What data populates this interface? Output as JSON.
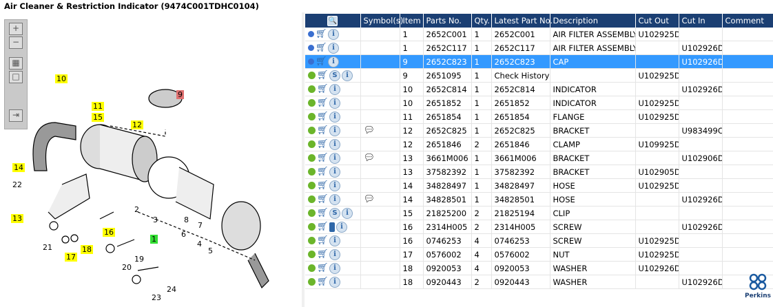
{
  "title": "Air Cleaner & Restriction Indicator (9474C001TDHC0104)",
  "headers": [
    "",
    "Symbol(s)",
    "Item",
    "Parts No.",
    "Qty.",
    "Latest Part No.",
    "Description",
    "Cut Out",
    "Cut In",
    "Comment"
  ],
  "rows": [
    {
      "icons": [
        "gears",
        "cart",
        "info"
      ],
      "sym": "",
      "item": "1",
      "part": "2652C001",
      "qty": "1",
      "latest": "2652C001",
      "desc": "AIR FILTER ASSEMBLY",
      "out": "U102925D",
      "in": "",
      "comment": ""
    },
    {
      "icons": [
        "gears",
        "cart",
        "info"
      ],
      "sym": "",
      "item": "1",
      "part": "2652C117",
      "qty": "1",
      "latest": "2652C117",
      "desc": "AIR FILTER ASSEMBLY",
      "out": "",
      "in": "U102926D",
      "comment": ""
    },
    {
      "icons": [
        "gears",
        "cart",
        "info"
      ],
      "sym": "",
      "item": "9",
      "part": "2652C823",
      "qty": "1",
      "latest": "2652C823",
      "desc": "CAP",
      "out": "",
      "in": "U102926D",
      "comment": "",
      "selected": true
    },
    {
      "icons": [
        "gear",
        "cart",
        "s",
        "info"
      ],
      "sym": "",
      "item": "9",
      "part": "2651095",
      "qty": "1",
      "latest": "Check History",
      "desc": "",
      "out": "U102925D",
      "in": "",
      "comment": ""
    },
    {
      "icons": [
        "gear",
        "cart",
        "info"
      ],
      "sym": "",
      "item": "10",
      "part": "2652C814",
      "qty": "1",
      "latest": "2652C814",
      "desc": "INDICATOR",
      "out": "",
      "in": "U102926D",
      "comment": ""
    },
    {
      "icons": [
        "gear",
        "cart",
        "info"
      ],
      "sym": "",
      "item": "10",
      "part": "2651852",
      "qty": "1",
      "latest": "2651852",
      "desc": "INDICATOR",
      "out": "U102925D",
      "in": "",
      "comment": ""
    },
    {
      "icons": [
        "gear",
        "cart",
        "info"
      ],
      "sym": "",
      "item": "11",
      "part": "2651854",
      "qty": "1",
      "latest": "2651854",
      "desc": "FLANGE",
      "out": "U102925D",
      "in": "",
      "comment": ""
    },
    {
      "icons": [
        "gear",
        "cart",
        "info"
      ],
      "sym": "note",
      "item": "12",
      "part": "2652C825",
      "qty": "1",
      "latest": "2652C825",
      "desc": "BRACKET",
      "out": "",
      "in": "U983499C",
      "comment": ""
    },
    {
      "icons": [
        "gear",
        "cart",
        "info"
      ],
      "sym": "",
      "item": "12",
      "part": "2651846",
      "qty": "2",
      "latest": "2651846",
      "desc": "CLAMP",
      "out": "U109925D",
      "in": "",
      "comment": ""
    },
    {
      "icons": [
        "gear",
        "cart",
        "info"
      ],
      "sym": "note",
      "item": "13",
      "part": "3661M006",
      "qty": "1",
      "latest": "3661M006",
      "desc": "BRACKET",
      "out": "",
      "in": "U102906D",
      "comment": ""
    },
    {
      "icons": [
        "gear",
        "cart",
        "info"
      ],
      "sym": "",
      "item": "13",
      "part": "37582392",
      "qty": "1",
      "latest": "37582392",
      "desc": "BRACKET",
      "out": "U102905D",
      "in": "",
      "comment": ""
    },
    {
      "icons": [
        "gear",
        "cart",
        "info"
      ],
      "sym": "",
      "item": "14",
      "part": "34828497",
      "qty": "1",
      "latest": "34828497",
      "desc": "HOSE",
      "out": "U102925D",
      "in": "",
      "comment": ""
    },
    {
      "icons": [
        "gear",
        "cart",
        "info"
      ],
      "sym": "note",
      "item": "14",
      "part": "34828501",
      "qty": "1",
      "latest": "34828501",
      "desc": "HOSE",
      "out": "",
      "in": "U102926D",
      "comment": ""
    },
    {
      "icons": [
        "gear",
        "cart",
        "s",
        "info"
      ],
      "sym": "",
      "item": "15",
      "part": "21825200",
      "qty": "2",
      "latest": "21825194",
      "desc": "CLIP",
      "out": "",
      "in": "",
      "comment": ""
    },
    {
      "icons": [
        "gear",
        "cart",
        "book",
        "info"
      ],
      "sym": "",
      "item": "16",
      "part": "2314H005",
      "qty": "2",
      "latest": "2314H005",
      "desc": "SCREW",
      "out": "",
      "in": "U102926D",
      "comment": ""
    },
    {
      "icons": [
        "gear",
        "cart",
        "info"
      ],
      "sym": "",
      "item": "16",
      "part": "0746253",
      "qty": "4",
      "latest": "0746253",
      "desc": "SCREW",
      "out": "U102925D",
      "in": "",
      "comment": ""
    },
    {
      "icons": [
        "gear",
        "cart",
        "info"
      ],
      "sym": "",
      "item": "17",
      "part": "0576002",
      "qty": "4",
      "latest": "0576002",
      "desc": "NUT",
      "out": "U102925D",
      "in": "",
      "comment": ""
    },
    {
      "icons": [
        "gear",
        "cart",
        "info"
      ],
      "sym": "",
      "item": "18",
      "part": "0920053",
      "qty": "4",
      "latest": "0920053",
      "desc": "WASHER",
      "out": "U102926D",
      "in": "",
      "comment": ""
    },
    {
      "icons": [
        "gear",
        "cart",
        "info"
      ],
      "sym": "",
      "item": "18",
      "part": "0920443",
      "qty": "2",
      "latest": "0920443",
      "desc": "WASHER",
      "out": "",
      "in": "U102926D",
      "comment": ""
    }
  ],
  "callouts": [
    {
      "t": "10",
      "c": "y"
    },
    {
      "t": "9",
      "c": "r"
    },
    {
      "t": "11",
      "c": "y"
    },
    {
      "t": "15",
      "c": "y"
    },
    {
      "t": "12",
      "c": "y"
    },
    {
      "t": "14",
      "c": "y"
    },
    {
      "t": "22",
      "c": ""
    },
    {
      "t": "13",
      "c": "y"
    },
    {
      "t": "16",
      "c": "y"
    },
    {
      "t": "1",
      "c": "g"
    },
    {
      "t": "21",
      "c": ""
    },
    {
      "t": "17",
      "c": "y"
    },
    {
      "t": "18",
      "c": "y"
    },
    {
      "t": "19",
      "c": ""
    },
    {
      "t": "20",
      "c": ""
    },
    {
      "t": "24",
      "c": ""
    },
    {
      "t": "23",
      "c": ""
    },
    {
      "t": "2",
      "c": ""
    },
    {
      "t": "3",
      "c": ""
    },
    {
      "t": "8",
      "c": ""
    },
    {
      "t": "7",
      "c": ""
    },
    {
      "t": "6",
      "c": ""
    },
    {
      "t": "4",
      "c": ""
    },
    {
      "t": "5",
      "c": ""
    }
  ],
  "logo": "Perkins"
}
